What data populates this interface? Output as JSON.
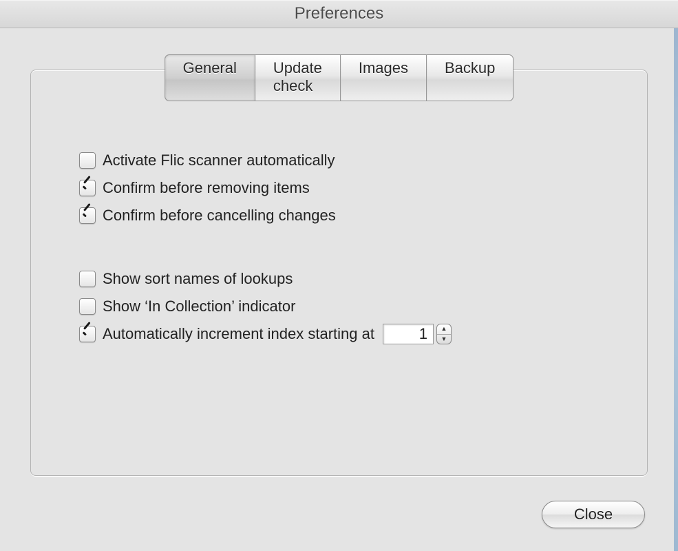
{
  "window": {
    "title": "Preferences"
  },
  "tabs": [
    {
      "label": "General",
      "selected": true
    },
    {
      "label": "Update check",
      "selected": false
    },
    {
      "label": "Images",
      "selected": false
    },
    {
      "label": "Backup",
      "selected": false
    }
  ],
  "options": {
    "activate_flic": {
      "label": "Activate Flic scanner automatically",
      "checked": false
    },
    "confirm_remove": {
      "label": "Confirm before removing items",
      "checked": true
    },
    "confirm_cancel": {
      "label": "Confirm before cancelling changes",
      "checked": true
    },
    "show_sort_names": {
      "label": "Show sort names of lookups",
      "checked": false
    },
    "show_in_collection": {
      "label": "Show ‘In Collection’ indicator",
      "checked": false
    },
    "auto_increment": {
      "label": "Automatically increment index starting at",
      "checked": true,
      "value": "1"
    }
  },
  "buttons": {
    "close": "Close"
  }
}
